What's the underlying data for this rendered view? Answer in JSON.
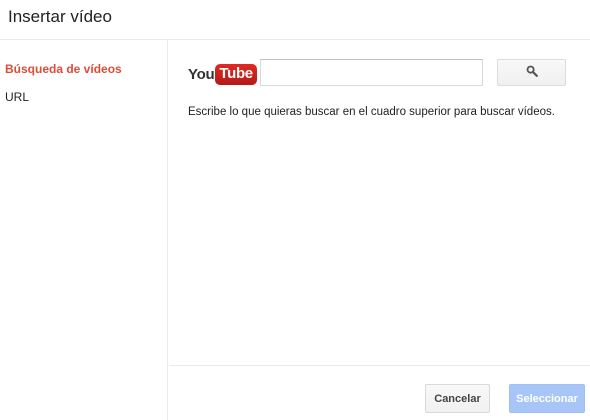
{
  "dialog": {
    "title": "Insertar vídeo"
  },
  "sidebar": {
    "items": [
      {
        "label": "Búsqueda de vídeos",
        "active": true
      },
      {
        "label": "URL",
        "active": false
      }
    ]
  },
  "main": {
    "logo": {
      "you": "You",
      "tube": "Tube"
    },
    "search": {
      "value": "",
      "placeholder": "",
      "button_icon": "search-icon"
    },
    "hint": "Escribe lo que quieras buscar en el cuadro superior para buscar vídeos."
  },
  "footer": {
    "cancel_label": "Cancelar",
    "select_label": "Seleccionar"
  },
  "colors": {
    "active_nav": "#dd4b39",
    "primary_disabled": "#a7c6f7"
  }
}
